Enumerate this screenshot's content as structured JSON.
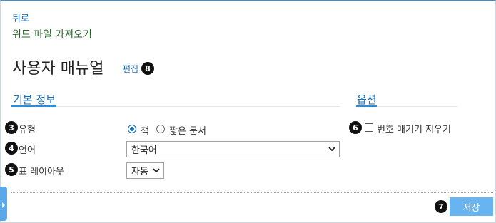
{
  "nav": {
    "back_label": "뒤로",
    "import_label": "워드 파일 가져오기"
  },
  "page": {
    "title": "사용자 매뉴얼",
    "edit_label": "편집"
  },
  "sections": {
    "basic_info": "기본 정보",
    "options": "옵션"
  },
  "fields": {
    "type": {
      "label": "유형",
      "options": [
        "책",
        "짧은 문서"
      ],
      "selected": "책"
    },
    "language": {
      "label": "언어",
      "value": "한국어"
    },
    "table_layout": {
      "label": "표 레이아웃",
      "value": "자동"
    }
  },
  "options": {
    "clear_numbering_label": "번호 매기기 지우기",
    "clear_numbering_checked": false
  },
  "actions": {
    "save_label": "저장"
  },
  "badges": [
    "3",
    "4",
    "5",
    "6",
    "7",
    "8"
  ],
  "colors": {
    "accent": "#1a6fb5",
    "save_button": "#68b4f0",
    "badge": "#111111"
  },
  "icons": {
    "expand": "chevron-right-icon",
    "dropdown": "chevron-down-icon"
  }
}
